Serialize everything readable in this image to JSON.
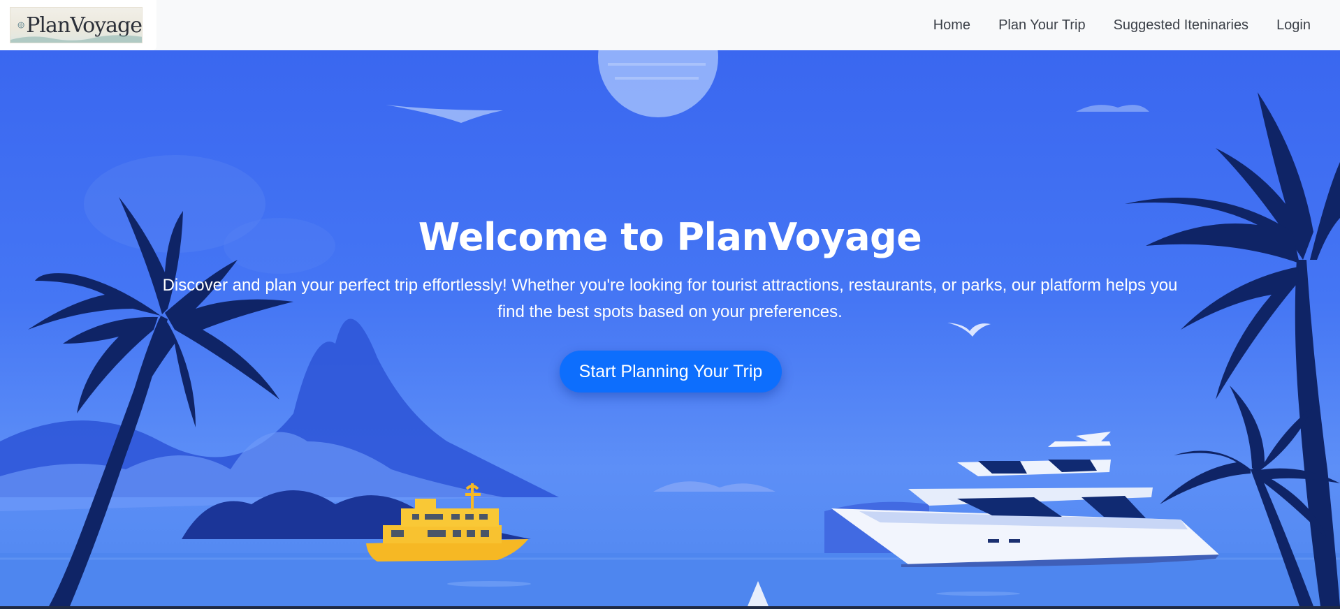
{
  "brand": {
    "logo_text": "PlanVoyage",
    "logo_icon": "compass-icon"
  },
  "nav": {
    "items": [
      {
        "label": "Home"
      },
      {
        "label": "Plan Your Trip"
      },
      {
        "label": "Suggested Iteninaries"
      },
      {
        "label": "Login"
      }
    ]
  },
  "hero": {
    "title": "Welcome to PlanVoyage",
    "subtitle": "Discover and plan your perfect trip effortlessly! Whether you're looking for tourist attractions, restaurants, or parks, our platform helps you find the best spots based on your preferences.",
    "cta_label": "Start Planning Your Trip"
  },
  "colors": {
    "navbar_bg": "#f8f9fa",
    "hero_sky": "#4576f4",
    "cta_bg": "#0d6efd",
    "palm": "#0f2466",
    "boat_yellow": "#f6b824",
    "yacht_white": "#f2f5fd"
  }
}
